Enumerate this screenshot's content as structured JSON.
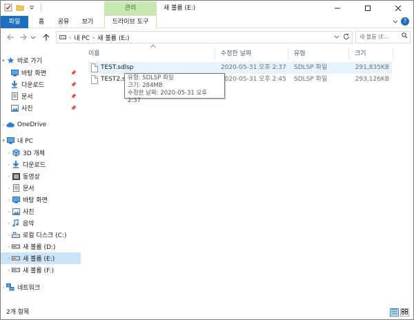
{
  "title": {
    "context_tab": "관리",
    "window_title": "새 볼륨 (E:)"
  },
  "ribbon": {
    "file": "파일",
    "home": "홈",
    "share": "공유",
    "view": "보기",
    "drive_tools": "드라이브 도구"
  },
  "address": {
    "pc": "내 PC",
    "volume": "새 볼륨 (E:)",
    "search_placeholder": "새 볼륨 (E..."
  },
  "nav": {
    "quick_access": "바로 가기",
    "qa_desktop": "바탕 화면",
    "qa_downloads": "다운로드",
    "qa_documents": "문서",
    "qa_pictures": "사진",
    "onedrive": "OneDrive",
    "this_pc": "내 PC",
    "objects3d": "3D 개체",
    "downloads": "다운로드",
    "videos": "동영상",
    "documents": "문서",
    "desktop": "바탕 화면",
    "pictures": "사진",
    "music": "음악",
    "local_disk_c": "로컬 디스크 (C:)",
    "volume_d": "새 볼륨 (D:)",
    "volume_e": "새 볼륨 (E:)",
    "volume_f": "새 볼륨 (F:)",
    "network": "네트워크"
  },
  "columns": {
    "name": "이름",
    "modified": "수정한 날짜",
    "type": "유형",
    "size": "크기"
  },
  "files": [
    {
      "name": "TEST.sdlsp",
      "modified": "2020-05-31 오후 2:37",
      "type": "SDLSP 파일",
      "size": "291,835KB"
    },
    {
      "name": "TEST2.sdlsp",
      "modified": "2020-05-31 오후 2:45",
      "type": "SDLSP 파일",
      "size": "293,126KB"
    }
  ],
  "tooltip": {
    "line_type": "유형: SDLSP 파일",
    "line_size": "크기: 284MB",
    "line_modified": "수정한 날짜: 2020-05-31 오후 2:37"
  },
  "status": {
    "item_count": "2개 항목"
  }
}
